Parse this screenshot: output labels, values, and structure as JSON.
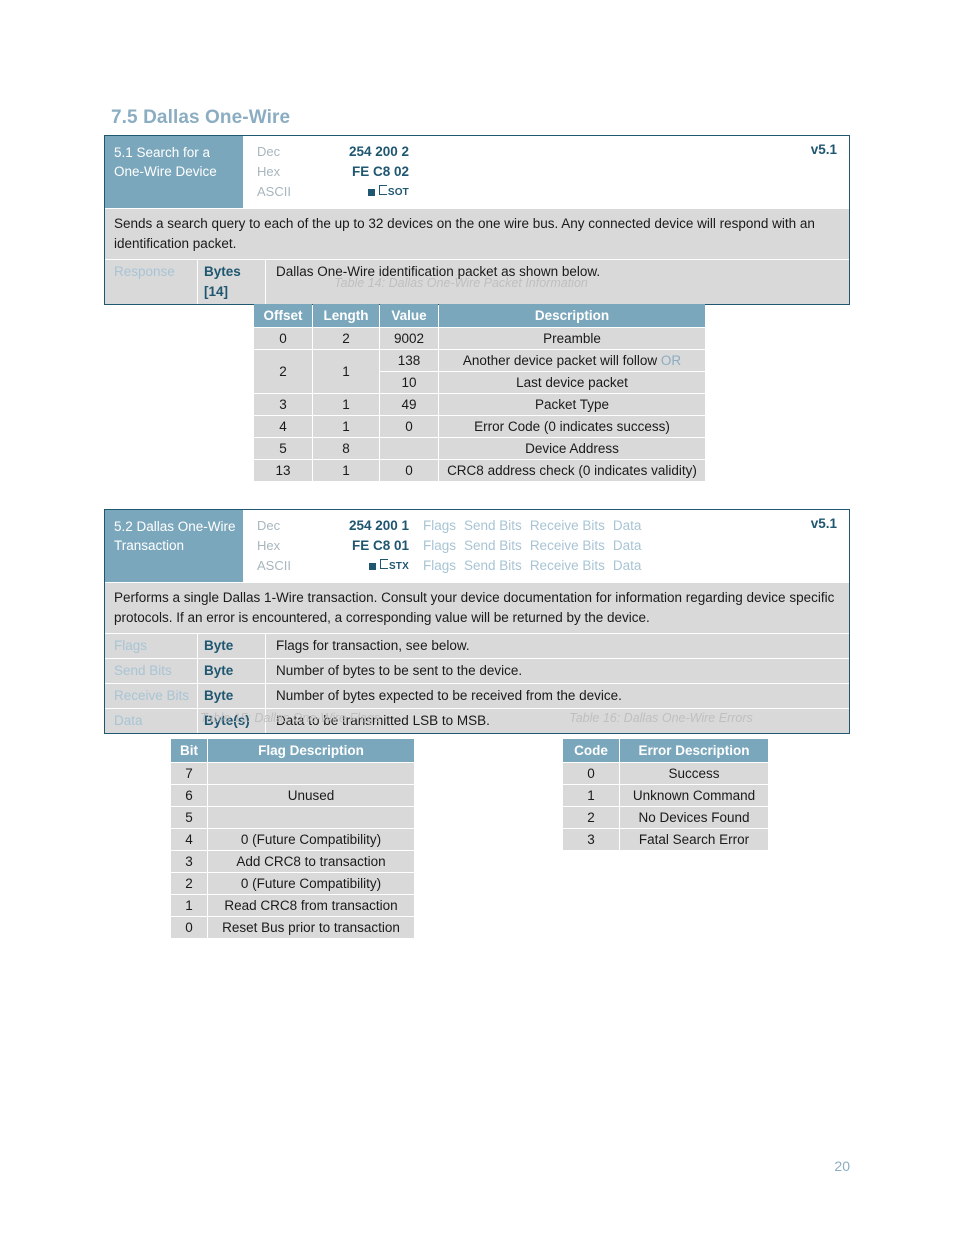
{
  "document": {
    "section_heading": "7.5 Dallas One-Wire",
    "page_number": "20"
  },
  "commands": [
    {
      "title": "5.1 Search for a One-Wire Device",
      "version": "v5.1",
      "rows": [
        {
          "label": "Dec",
          "value": "254 200 2",
          "args": []
        },
        {
          "label": "Hex",
          "value": "FE C8 02",
          "args": []
        },
        {
          "label": "ASCII",
          "value": "",
          "ascii_control": "SOT",
          "args": []
        }
      ],
      "description": "Sends a search query to each of the up to 32 devices on the one wire bus.  Any connected device will respond with an identification packet.",
      "params": [
        {
          "name": "Response",
          "type": "Bytes [14]",
          "desc": "Dallas One-Wire identification packet as shown below."
        }
      ]
    },
    {
      "title": "5.2 Dallas One-Wire Transaction",
      "version": "v5.1",
      "rows": [
        {
          "label": "Dec",
          "value": "254 200 1",
          "args": [
            "Flags",
            "Send Bits",
            "Receive Bits",
            "Data"
          ]
        },
        {
          "label": "Hex",
          "value": "FE C8 01",
          "args": [
            "Flags",
            "Send Bits",
            "Receive Bits",
            "Data"
          ]
        },
        {
          "label": "ASCII",
          "value": "",
          "ascii_control": "STX",
          "args": [
            "Flags",
            "Send Bits",
            "Receive Bits",
            "Data"
          ]
        }
      ],
      "description": "Performs a single Dallas 1-Wire transaction.  Consult your device documentation for information regarding device specific protocols.  If an error is encountered, a corresponding value will be returned by the device.",
      "params": [
        {
          "name": "Flags",
          "type": "Byte",
          "desc": "Flags for transaction, see below."
        },
        {
          "name": "Send Bits",
          "type": "Byte",
          "desc": "Number of bytes to be sent to the device."
        },
        {
          "name": "Receive Bits",
          "type": "Byte",
          "desc": "Number of bytes expected to be received from the device."
        },
        {
          "name": "Data",
          "type": "Byte(s)",
          "desc": "Data to be transmitted LSB to MSB."
        }
      ]
    }
  ],
  "tables": [
    {
      "id": "table-14",
      "caption": "Table 14: Dallas One-Wire Packet Information",
      "headers": [
        "Offset",
        "Length",
        "Value",
        "Description"
      ],
      "rows": [
        {
          "offset": "0",
          "length": "2",
          "value": "9002",
          "desc": "Preamble"
        },
        {
          "offset": "2",
          "length": "1",
          "value": "138",
          "desc": "Another device packet will follow ",
          "desc_accent": "OR",
          "rowspan": 2
        },
        {
          "offset": "",
          "length": "",
          "value": "10",
          "desc": "Last device packet"
        },
        {
          "offset": "3",
          "length": "1",
          "value": "49",
          "desc": "Packet Type"
        },
        {
          "offset": "4",
          "length": "1",
          "value": "0",
          "desc": "Error Code (0 indicates success)"
        },
        {
          "offset": "5",
          "length": "8",
          "value": "",
          "desc": "Device Address"
        },
        {
          "offset": "13",
          "length": "1",
          "value": "0",
          "desc": "CRC8 address check (0 indicates validity)"
        }
      ]
    },
    {
      "id": "table-15",
      "caption": "Table 15: Dallas One-Wire Flags",
      "headers": [
        "Bit",
        "Flag Description"
      ],
      "rows": [
        {
          "bit": "7",
          "desc": ""
        },
        {
          "bit": "6",
          "desc": "Unused"
        },
        {
          "bit": "5",
          "desc": ""
        },
        {
          "bit": "4",
          "desc": "0 (Future Compatibility)"
        },
        {
          "bit": "3",
          "desc": "Add CRC8 to transaction"
        },
        {
          "bit": "2",
          "desc": "0 (Future Compatibility)"
        },
        {
          "bit": "1",
          "desc": "Read CRC8 from transaction"
        },
        {
          "bit": "0",
          "desc": "Reset Bus prior to transaction"
        }
      ]
    },
    {
      "id": "table-16",
      "caption": "Table 16: Dallas One-Wire Errors",
      "headers": [
        "Code",
        "Error Description"
      ],
      "rows": [
        {
          "code": "0",
          "desc": "Success"
        },
        {
          "code": "1",
          "desc": "Unknown Command"
        },
        {
          "code": "2",
          "desc": "No Devices Found"
        },
        {
          "code": "3",
          "desc": "Fatal Search Error"
        }
      ]
    }
  ],
  "colors": {
    "accent_light": "#8BADC2",
    "header_blue": "#7BA7BC",
    "dark_teal": "#1F5670",
    "cell_gray": "#D9D9D9",
    "arg_blue": "#A8C4D4"
  }
}
